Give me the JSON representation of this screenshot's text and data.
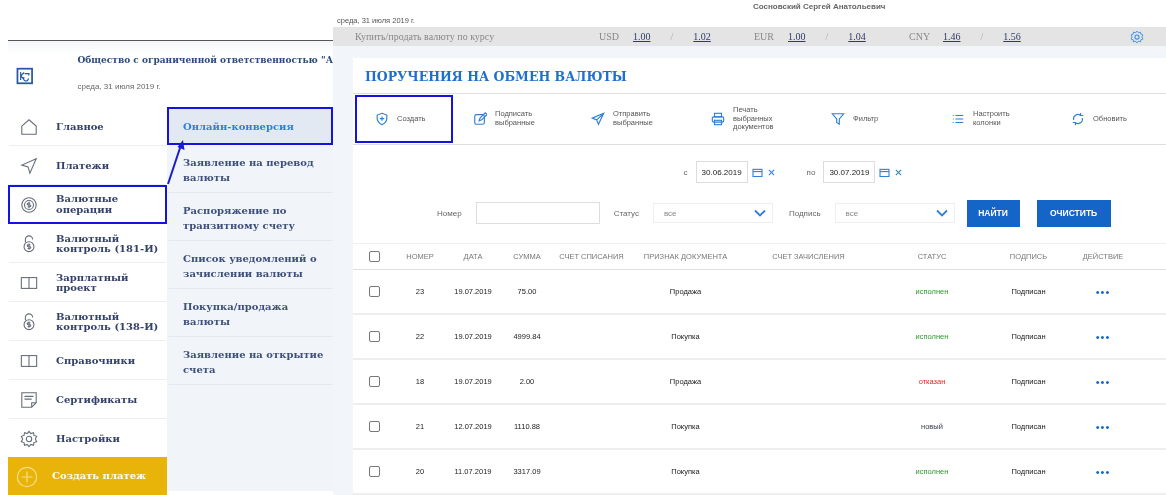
{
  "header": {
    "user_name": "Сосновский Сергей Анатольевич",
    "date": "среда, 31 июля 2019 г."
  },
  "rates_bar": {
    "label": "Купить/продать валюту по курсу",
    "rates": [
      {
        "currency": "USD",
        "buy": "1.00",
        "separator": "/",
        "sell": "1.02"
      },
      {
        "currency": "EUR",
        "buy": "1.00",
        "separator": "/",
        "sell": "1.04"
      },
      {
        "currency": "CNY",
        "buy": "1.46",
        "separator": "/",
        "sell": "1.56"
      }
    ]
  },
  "page": {
    "title": "ПОРУЧЕНИЯ НА ОБМЕН ВАЛЮТЫ",
    "toolbar": [
      {
        "label": "Создать",
        "highlighted": true
      },
      {
        "label": "Подписать\nвыбранные",
        "highlighted": false
      },
      {
        "label": "Отправить\nвыбранные",
        "highlighted": false
      },
      {
        "label": "Печать\nвыбранных\nдокументов",
        "highlighted": false
      },
      {
        "label": "Фильтр",
        "highlighted": false
      },
      {
        "label": "Настроить\nколонки",
        "highlighted": false
      },
      {
        "label": "Обновить",
        "highlighted": false
      }
    ],
    "filters": {
      "date_from_label": "с",
      "date_from": "30.06.2019",
      "date_to_label": "по",
      "date_to": "30.07.2019",
      "number_label": "Номер",
      "status_label": "Статус",
      "status_value": "все",
      "signature_label": "Подпись",
      "signature_value": "все",
      "buttons": [
        "НАЙТИ",
        "ОЧИСТИТЬ"
      ]
    },
    "table": {
      "header_checked": false,
      "columns": [
        "НОМЕР",
        "ДАТА",
        "СУММА",
        "СЧЕТ СПИСАНИЯ",
        "ПРИЗНАК ДОКУМЕНТА",
        "СЧЕТ ЗАЧИСЛЕНИЯ",
        "СТАТУС",
        "ПОДПИСЬ",
        "ДЕЙСТВИЕ"
      ],
      "rows": [
        {
          "checked": false,
          "number": "23",
          "date": "19.07.2019",
          "amount": "75.00",
          "type": "Продажа",
          "status": "исполнен",
          "kind": "done",
          "signature": "Подписан",
          "action": "•••"
        },
        {
          "checked": false,
          "number": "22",
          "date": "19.07.2019",
          "amount": "4999.84",
          "type": "Покупка",
          "status": "исполнен",
          "kind": "done",
          "signature": "Подписан",
          "action": "•••"
        },
        {
          "checked": false,
          "number": "18",
          "date": "19.07.2019",
          "amount": "2.00",
          "type": "Продажа",
          "status": "отказан",
          "kind": "rejected",
          "signature": "Подписан",
          "action": "•••"
        },
        {
          "checked": false,
          "number": "21",
          "date": "12.07.2019",
          "amount": "1110.88",
          "type": "Покупка",
          "status": "новый",
          "kind": "new",
          "signature": "Подписан",
          "action": "•••"
        },
        {
          "checked": false,
          "number": "20",
          "date": "11.07.2019",
          "amount": "3317.09",
          "type": "Покупка",
          "status": "исполнен",
          "kind": "done",
          "signature": "Подписан",
          "action": "•••"
        }
      ]
    }
  },
  "sidebar": {
    "org_name": "Общество с ограниченной ответственностью \"А",
    "date": "среда, 31 июля 2019 г.",
    "menu": [
      {
        "label": "Главное",
        "highlighted": false
      },
      {
        "label": "Платежи",
        "highlighted": false
      },
      {
        "label": "Валютные\nоперации",
        "highlighted": true
      },
      {
        "label": "Валютный\nконтроль (181-И)",
        "highlighted": false
      },
      {
        "label": "Зарплатный\nпроект",
        "highlighted": false
      },
      {
        "label": "Валютный\nконтроль (138-И)",
        "highlighted": false
      },
      {
        "label": "Справочники",
        "highlighted": false
      },
      {
        "label": "Сертификаты",
        "highlighted": false
      },
      {
        "label": "Настройки",
        "highlighted": false
      }
    ],
    "submenu": [
      {
        "label": "Онлайн-конверсия",
        "selected": true,
        "highlighted": true
      },
      {
        "label": "Заявление на перевод валюты",
        "selected": false,
        "highlighted": false
      },
      {
        "label": "Распоряжение по транзитному счету",
        "selected": false,
        "highlighted": false
      },
      {
        "label": "Список уведомлений о зачислении валюты",
        "selected": false,
        "highlighted": false
      },
      {
        "label": "Покупка/продажа валюты",
        "selected": false,
        "highlighted": false
      },
      {
        "label": "Заявление на открытие счета",
        "selected": false,
        "highlighted": false
      }
    ],
    "create_button": "Создать платеж"
  }
}
